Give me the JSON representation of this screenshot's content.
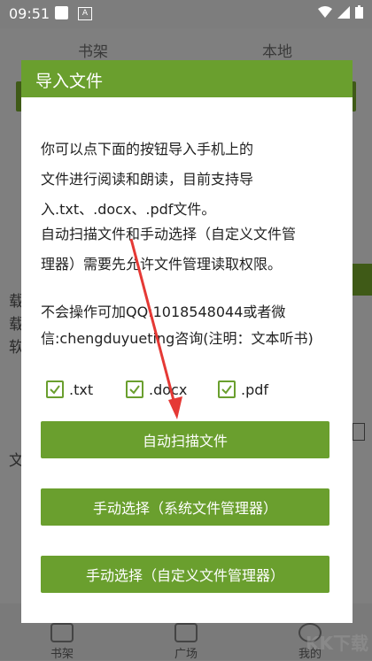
{
  "status_bar": {
    "time": "09:51",
    "a_icon": "A"
  },
  "background": {
    "tabs": {
      "bookshelf": "书架",
      "local": "本地"
    },
    "left_chars": [
      "载",
      "载",
      "软",
      "文"
    ],
    "bottom_nav": {
      "bookshelf": "书架",
      "square": "广场",
      "mine": "我的"
    }
  },
  "dialog": {
    "title": "导入文件",
    "message_lines": [
      "你可以点下面的按钮导入手机上的",
      "文件进行阅读和朗读，目前支持导",
      "入.txt、.docx、.pdf文件。",
      "自动扫描文件和手动选择（自定义文件管",
      "理器）需要先允许文件管理读取权限。"
    ],
    "contact_lines": [
      "不会操作可加QQ:1018548044或者微",
      "信:chengduyueting咨询(注明：文本听书)"
    ],
    "checkboxes": [
      ".txt",
      ".docx",
      ".pdf"
    ],
    "buttons": {
      "auto_scan": "自动扫描文件",
      "manual_system": "手动选择（系统文件管理器）",
      "manual_custom": "手动选择（自定义文件管理器）"
    }
  },
  "watermark": "KK下载",
  "colors": {
    "accent": "#6a9f2e",
    "arrow": "#e53935"
  }
}
